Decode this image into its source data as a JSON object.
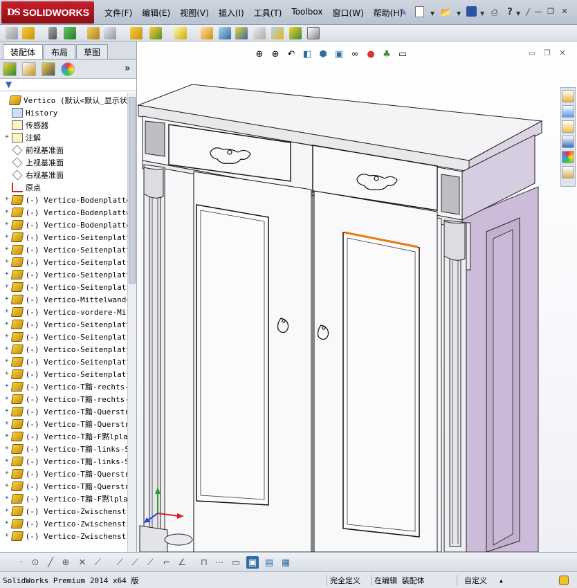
{
  "app": {
    "logo_ds": "DS",
    "logo_brand": "SOLIDWORKS"
  },
  "menu": [
    "文件(F)",
    "编辑(E)",
    "视图(V)",
    "插入(I)",
    "工具(T)",
    "Toolbox",
    "窗口(W)",
    "帮助(H)"
  ],
  "left_panel": {
    "tabs": [
      "装配体",
      "布局",
      "草图"
    ],
    "active_tab": 0,
    "collapse_glyph": "»",
    "tree": [
      {
        "text": "Vertico  (默认<默认_显示状",
        "icon": "assembly-icon",
        "indent": 0,
        "expand": ""
      },
      {
        "text": "History",
        "icon": "history-icon",
        "indent": 1,
        "expand": ""
      },
      {
        "text": "传感器",
        "icon": "sensor-icon",
        "indent": 1,
        "expand": ""
      },
      {
        "text": "注解",
        "icon": "annotation-icon",
        "indent": 1,
        "expand": "+"
      },
      {
        "text": "前视基准面",
        "icon": "plane-icon",
        "indent": 1,
        "expand": ""
      },
      {
        "text": "上视基准面",
        "icon": "plane-icon",
        "indent": 1,
        "expand": ""
      },
      {
        "text": "右视基准面",
        "icon": "plane-icon",
        "indent": 1,
        "expand": ""
      },
      {
        "text": "原点",
        "icon": "origin-icon",
        "indent": 1,
        "expand": ""
      },
      {
        "text": "(-) Vertico-Bodenplatte",
        "icon": "part-icon",
        "indent": 1,
        "expand": "+"
      },
      {
        "text": "(-) Vertico-Bodenplatte",
        "icon": "part-icon",
        "indent": 1,
        "expand": "+"
      },
      {
        "text": "(-) Vertico-Bodenplatte",
        "icon": "part-icon",
        "indent": 1,
        "expand": "+"
      },
      {
        "text": "(-) Vertico-Seitenplatt",
        "icon": "part-icon",
        "indent": 1,
        "expand": "+"
      },
      {
        "text": "(-) Vertico-Seitenplatt",
        "icon": "part-icon",
        "indent": 1,
        "expand": "+"
      },
      {
        "text": "(-) Vertico-Seitenplatt",
        "icon": "part-icon",
        "indent": 1,
        "expand": "+"
      },
      {
        "text": "(-) Vertico-Seitenplatt",
        "icon": "part-icon",
        "indent": 1,
        "expand": "+"
      },
      {
        "text": "(-) Vertico-Seitenplatt",
        "icon": "part-icon",
        "indent": 1,
        "expand": "+"
      },
      {
        "text": "(-) Vertico-Mittelwand<",
        "icon": "part-icon",
        "indent": 1,
        "expand": "+"
      },
      {
        "text": "(-) Vertico-vordere-Mit",
        "icon": "part-icon",
        "indent": 1,
        "expand": "+"
      },
      {
        "text": "(-) Vertico-Seitenplatt",
        "icon": "part-icon",
        "indent": 1,
        "expand": "+"
      },
      {
        "text": "(-) Vertico-Seitenplatt",
        "icon": "part-icon",
        "indent": 1,
        "expand": "+"
      },
      {
        "text": "(-) Vertico-Seitenplatt",
        "icon": "part-icon",
        "indent": 1,
        "expand": "+"
      },
      {
        "text": "(-) Vertico-Seitenplatt",
        "icon": "part-icon",
        "indent": 1,
        "expand": "+"
      },
      {
        "text": "(-) Vertico-Seitenplatt",
        "icon": "part-icon",
        "indent": 1,
        "expand": "+"
      },
      {
        "text": "(-) Vertico-T黯-rechts-",
        "icon": "part-icon",
        "indent": 1,
        "expand": "+"
      },
      {
        "text": "(-) Vertico-T黯-rechts-",
        "icon": "part-icon",
        "indent": 1,
        "expand": "+"
      },
      {
        "text": "(-) Vertico-T黯-Querstr",
        "icon": "part-icon",
        "indent": 1,
        "expand": "+"
      },
      {
        "text": "(-) Vertico-T黯-Querstr",
        "icon": "part-icon",
        "indent": 1,
        "expand": "+"
      },
      {
        "text": "(-) Vertico-T黯-F黙lpla",
        "icon": "part-icon",
        "indent": 1,
        "expand": "+"
      },
      {
        "text": "(-) Vertico-T黯-links-S",
        "icon": "part-icon",
        "indent": 1,
        "expand": "+"
      },
      {
        "text": "(-) Vertico-T黯-links-S",
        "icon": "part-icon",
        "indent": 1,
        "expand": "+"
      },
      {
        "text": "(-) Vertico-T黯-Querstr",
        "icon": "part-icon",
        "indent": 1,
        "expand": "+"
      },
      {
        "text": "(-) Vertico-T黯-Querstr",
        "icon": "part-icon",
        "indent": 1,
        "expand": "+"
      },
      {
        "text": "(-) Vertico-T黯-F黙lpla",
        "icon": "part-icon",
        "indent": 1,
        "expand": "+"
      },
      {
        "text": "(-) Vertico-Zwischenstr",
        "icon": "part-icon",
        "indent": 1,
        "expand": "+"
      },
      {
        "text": "(-) Vertico-Zwischenstr",
        "icon": "part-icon",
        "indent": 1,
        "expand": "+"
      },
      {
        "text": "(-) Vertico-Zwischenstr",
        "icon": "part-icon",
        "indent": 1,
        "expand": "+"
      }
    ]
  },
  "status": {
    "version": "SolidWorks Premium 2014 x64 版",
    "defined": "完全定义",
    "editing": "在编辑 装配体",
    "units": "自定义",
    "units_arrow": "▲"
  },
  "colors": {
    "selection_edge": "#e87a10",
    "cabinet_side": "#c9b8d6",
    "title_bg": "#c7d0dc"
  }
}
